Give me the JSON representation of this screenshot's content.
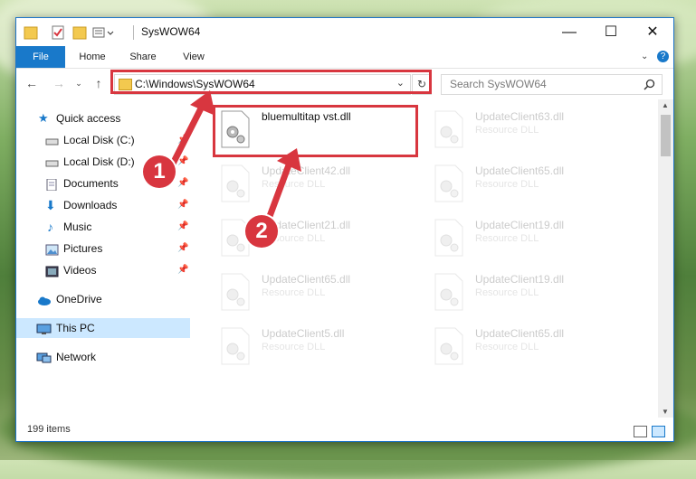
{
  "window": {
    "title": "SysWOW64",
    "controls": {
      "minimize": "—",
      "maximize": "☐",
      "close": "✕"
    }
  },
  "ribbon": {
    "tabs": [
      "File",
      "Home",
      "Share",
      "View"
    ]
  },
  "address": {
    "path": "C:\\Windows\\SysWOW64",
    "search_placeholder": "Search SysWOW64"
  },
  "nav": {
    "items": [
      {
        "label": "Quick access",
        "icon": "star-icon",
        "pinned": false
      },
      {
        "label": "Local Disk (C:)",
        "icon": "drive-icon",
        "pinned": true
      },
      {
        "label": "Local Disk (D:)",
        "icon": "drive-icon",
        "pinned": true
      },
      {
        "label": "Documents",
        "icon": "documents-icon",
        "pinned": true
      },
      {
        "label": "Downloads",
        "icon": "download-icon",
        "pinned": true
      },
      {
        "label": "Music",
        "icon": "music-icon",
        "pinned": true
      },
      {
        "label": "Pictures",
        "icon": "pictures-icon",
        "pinned": true
      },
      {
        "label": "Videos",
        "icon": "videos-icon",
        "pinned": true
      },
      {
        "label": "OneDrive",
        "icon": "cloud-icon",
        "pinned": false
      },
      {
        "label": "This PC",
        "icon": "computer-icon",
        "pinned": false,
        "selected": true
      },
      {
        "label": "Network",
        "icon": "network-icon",
        "pinned": false
      }
    ]
  },
  "files": {
    "featured": {
      "name": "bluemultitap vst.dll",
      "type": ""
    },
    "faded": [
      {
        "name": "UpdateClient63.dll",
        "type": "Resource DLL"
      },
      {
        "name": "UpdateClient42.dll",
        "type": "Resource DLL"
      },
      {
        "name": "UpdateClient65.dll",
        "type": "Resource DLL"
      },
      {
        "name": "UpdateClient21.dll",
        "type": "Resource DLL"
      },
      {
        "name": "UpdateClient19.dll",
        "type": "Resource DLL"
      },
      {
        "name": "UpdateClient65.dll",
        "type": "Resource DLL"
      },
      {
        "name": "UpdateClient19.dll",
        "type": "Resource DLL"
      },
      {
        "name": "UpdateClient5.dll",
        "type": "Resource DLL"
      },
      {
        "name": "UpdateClient65.dll",
        "type": "Resource DLL"
      }
    ]
  },
  "status": {
    "item_count": "199 items"
  },
  "annotations": {
    "step1": "1",
    "step2": "2",
    "color": "#d8363f"
  }
}
